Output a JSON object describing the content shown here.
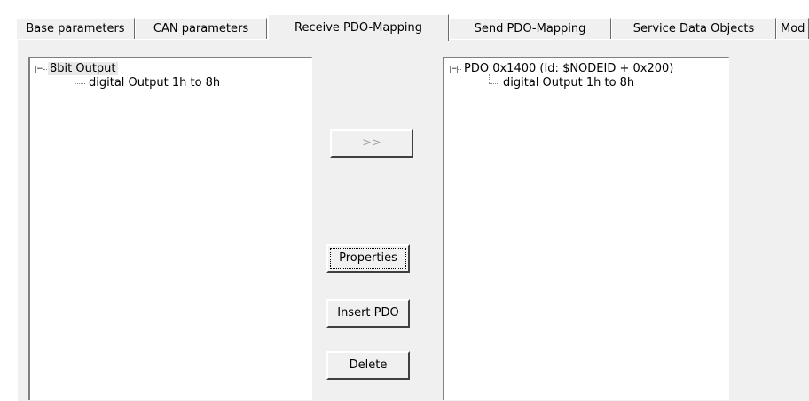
{
  "tabs": [
    {
      "label": "Base parameters",
      "active": false
    },
    {
      "label": "CAN parameters",
      "active": false
    },
    {
      "label": "Receive PDO-Mapping",
      "active": true
    },
    {
      "label": "Send PDO-Mapping",
      "active": false
    },
    {
      "label": "Service Data Objects",
      "active": false
    },
    {
      "label": "Mod",
      "active": false
    }
  ],
  "left_tree": {
    "root": {
      "label": "8bit Output",
      "expanded": true,
      "selected": true
    },
    "child": {
      "label": "digital Output 1h to 8h"
    }
  },
  "right_tree": {
    "root": {
      "label": "PDO 0x1400 (Id: $NODEID + 0x200)",
      "expanded": true
    },
    "child": {
      "label": "digital Output 1h to 8h"
    }
  },
  "buttons": {
    "add": {
      "label": ">>",
      "enabled": false
    },
    "properties": {
      "label": "Properties"
    },
    "insert_pdo": {
      "label": "Insert PDO"
    },
    "delete": {
      "label": "Delete"
    }
  },
  "icons": {
    "expander": "minus-box-icon"
  },
  "colors": {
    "panel": "#f0f0f0",
    "tree_bg": "#ffffff",
    "disabled_text": "#a0a0a0"
  }
}
